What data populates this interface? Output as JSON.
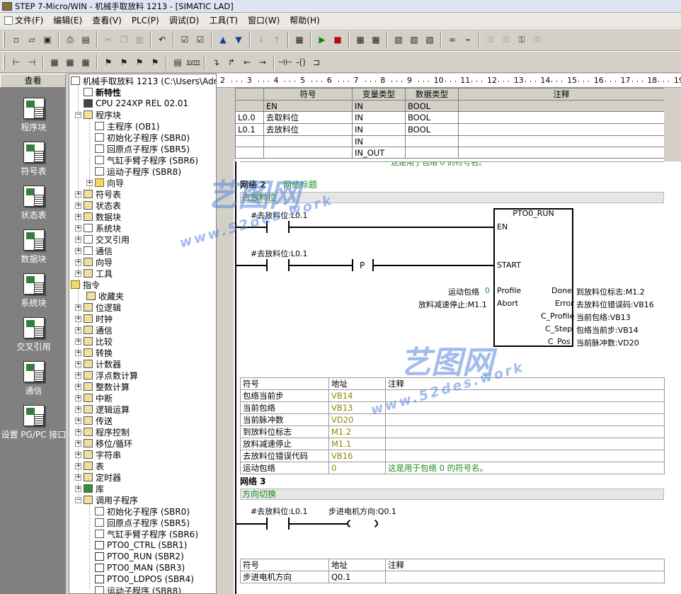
{
  "window": {
    "title": "STEP 7-Micro/WIN - 机械手取放料 1213 - [SIMATIC LAD]"
  },
  "menu": [
    "文件(F)",
    "编辑(E)",
    "查看(V)",
    "PLC(P)",
    "调试(D)",
    "工具(T)",
    "窗口(W)",
    "帮助(H)"
  ],
  "toolbar2": {
    "sym": "sym"
  },
  "nav": {
    "header": "查看",
    "items": [
      {
        "label": "程序块"
      },
      {
        "label": "符号表"
      },
      {
        "label": "状态表"
      },
      {
        "label": "数据块"
      },
      {
        "label": "系统块"
      },
      {
        "label": "交叉引用"
      },
      {
        "label": "通信"
      },
      {
        "label": "设置 PG/PC 接口"
      }
    ]
  },
  "tree": {
    "items": [
      {
        "text": "机械手取放料 1213 (C:\\Users\\Admin"
      },
      {
        "text": "新特性"
      },
      {
        "text": "CPU 224XP REL 02.01"
      },
      {
        "text": "程序块"
      },
      {
        "text": "主程序 (OB1)"
      },
      {
        "text": "初始化子程序 (SBR0)"
      },
      {
        "text": "回原点子程序 (SBR5)"
      },
      {
        "text": "气缸手臂子程序 (SBR6)"
      },
      {
        "text": "运动子程序 (SBR8)"
      },
      {
        "text": "向导"
      },
      {
        "text": "符号表"
      },
      {
        "text": "状态表"
      },
      {
        "text": "数据块"
      },
      {
        "text": "系统块"
      },
      {
        "text": "交叉引用"
      },
      {
        "text": "通信"
      },
      {
        "text": "向导"
      },
      {
        "text": "工具"
      },
      {
        "text": "指令"
      },
      {
        "text": "收藏夹"
      },
      {
        "text": "位逻辑"
      },
      {
        "text": "时钟"
      },
      {
        "text": "通信"
      },
      {
        "text": "比较"
      },
      {
        "text": "转换"
      },
      {
        "text": "计数器"
      },
      {
        "text": "浮点数计算"
      },
      {
        "text": "整数计算"
      },
      {
        "text": "中断"
      },
      {
        "text": "逻辑运算"
      },
      {
        "text": "传送"
      },
      {
        "text": "程序控制"
      },
      {
        "text": "移位/循环"
      },
      {
        "text": "字符串"
      },
      {
        "text": "表"
      },
      {
        "text": "定时器"
      },
      {
        "text": "库"
      },
      {
        "text": "调用子程序"
      },
      {
        "text": "初始化子程序 (SBR0)"
      },
      {
        "text": "回原点子程序 (SBR5)"
      },
      {
        "text": "气缸手臂子程序 (SBR6)"
      },
      {
        "text": "PTO0_CTRL (SBR1)"
      },
      {
        "text": "PTO0_RUN (SBR2)"
      },
      {
        "text": "PTO0_MAN (SBR3)"
      },
      {
        "text": "PTO0_LDPOS (SBR4)"
      },
      {
        "text": "运动子程序 (SBR8)"
      }
    ]
  },
  "ruler": [
    "2",
    "3",
    "4",
    "5",
    "6",
    "7",
    "8",
    "9",
    "10",
    "11",
    "12",
    "13",
    "14",
    "15",
    "16",
    "17",
    "18",
    "19"
  ],
  "var_table": {
    "headers": [
      "符号",
      "变量类型",
      "数据类型",
      "注释"
    ],
    "rows": [
      {
        "addr": "",
        "sym": "EN",
        "vtype": "IN",
        "dtype": "BOOL",
        "comment": ""
      },
      {
        "addr": "L0.0",
        "sym": "去取料位",
        "vtype": "IN",
        "dtype": "BOOL",
        "comment": ""
      },
      {
        "addr": "L0.1",
        "sym": "去放料位",
        "vtype": "IN",
        "dtype": "BOOL",
        "comment": ""
      },
      {
        "addr": "",
        "sym": "",
        "vtype": "IN",
        "dtype": "",
        "comment": ""
      },
      {
        "addr": "",
        "sym": "",
        "vtype": "IN_OUT",
        "dtype": "",
        "comment": ""
      }
    ],
    "partial_row": "这是用于包络 0 的符号名。"
  },
  "network2": {
    "title": "网络 2",
    "title_comment": "网络标题",
    "comment": "去放料位",
    "contact1": "#去放料位:L0.1",
    "contact2": "#去放料位:L0.1",
    "p_label": "P",
    "box": {
      "name": "PTO0_RUN",
      "en": "EN",
      "start": "START",
      "profile": "Profile",
      "abort": "Abort",
      "done": "Done",
      "error": "Error",
      "c_profile": "C_Profile",
      "c_step": "C_Step",
      "c_pos": "C_Pos"
    },
    "in_profile_name": "运动包络",
    "in_profile_val": "0",
    "in_abort": "放料减速停止:M1.1",
    "out_done": "到放料位标志:M1.2",
    "out_error": "去放料位错误码:VB16",
    "out_cprofile": "当前包络:VB13",
    "out_cstep": "包络当前步:VB14",
    "out_cpos": "当前脉冲数:VD20",
    "sym_table": {
      "headers": [
        "符号",
        "地址",
        "注释"
      ],
      "rows": [
        {
          "sym": "包络当前步",
          "addr": "VB14",
          "comment": ""
        },
        {
          "sym": "当前包络",
          "addr": "VB13",
          "comment": ""
        },
        {
          "sym": "当前脉冲数",
          "addr": "VD20",
          "comment": ""
        },
        {
          "sym": "到放料位标志",
          "addr": "M1.2",
          "comment": ""
        },
        {
          "sym": "放料减速停止",
          "addr": "M1.1",
          "comment": ""
        },
        {
          "sym": "去放料位错误代码",
          "addr": "VB16",
          "comment": ""
        },
        {
          "sym": "运动包络",
          "addr": "0",
          "comment": "这是用于包络 0 的符号名。"
        }
      ]
    }
  },
  "network3": {
    "title": "网络 3",
    "comment": "方向切换",
    "contact": "#去放料位:L0.1",
    "coil": "步进电机方向:Q0.1",
    "sym_table": {
      "headers": [
        "符号",
        "地址",
        "注释"
      ],
      "rows": [
        {
          "sym": "步进电机方向",
          "addr": "Q0.1",
          "comment": ""
        }
      ]
    }
  },
  "watermark": {
    "brand": "艺图网",
    "url": "www.52des.work"
  },
  "colors": {
    "accent_green": "#1a8a1a",
    "olive": "#8a8a00",
    "panel": "#808080",
    "chrome": "#d4d0c8"
  }
}
